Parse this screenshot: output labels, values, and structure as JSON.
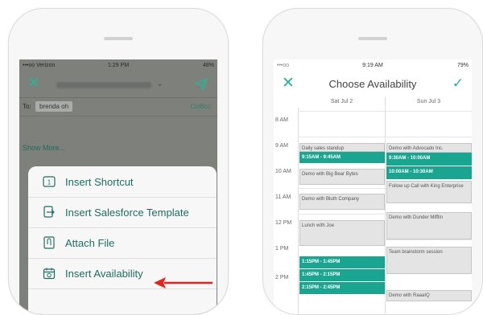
{
  "left_phone": {
    "status": {
      "carrier": "•••oo Verizon",
      "time": "1:29 PM",
      "battery": "48%"
    },
    "email": {
      "to_label": "To:",
      "recipient": "brenda oh",
      "cc_bcc": "Cc/Bcc",
      "show_more": "Show More..."
    },
    "menu": [
      {
        "label": "Insert Shortcut",
        "icon": "shortcut-icon"
      },
      {
        "label": "Insert Salesforce Template",
        "icon": "template-icon"
      },
      {
        "label": "Attach File",
        "icon": "attach-file-icon"
      },
      {
        "label": "Insert Availability",
        "icon": "calendar-icon"
      }
    ]
  },
  "right_phone": {
    "status": {
      "carrier": "•••oo",
      "time": "9:19 AM",
      "battery": "79%"
    },
    "title": "Choose Availability",
    "days": [
      "Sat Jul 2",
      "Sun Jul 3"
    ],
    "hours": [
      "8 AM",
      "9 AM",
      "10 AM",
      "11 AM",
      "12 PM",
      "1 PM",
      "2 PM"
    ],
    "events": [
      {
        "label": "Daily sales standup"
      },
      {
        "label": "Demo with Big Bear Bytes"
      },
      {
        "label": "Demo with Bluth Company"
      },
      {
        "label": "Lunch with Joe"
      },
      {
        "label": "Demo with Advocado Inc."
      },
      {
        "label": "Follow up Call with King Enterprise"
      },
      {
        "label": "Demo with Dunder Mifflin"
      },
      {
        "label": "Team brainstorm session"
      },
      {
        "label": "Demo with RaaaIQ"
      }
    ],
    "slots": [
      {
        "label": "9:15AM - 9:45AM"
      },
      {
        "label": "1:15PM - 1:45PM"
      },
      {
        "label": "1:45PM - 2:15PM"
      },
      {
        "label": "2:15PM - 2:45PM"
      },
      {
        "label": "9:30AM - 10:00AM"
      },
      {
        "label": "10:00AM - 10:30AM"
      }
    ]
  },
  "colors": {
    "accent": "#1aa590",
    "overlay": "#7e807c",
    "link": "#1e6d63",
    "arrow": "#e8221d"
  }
}
